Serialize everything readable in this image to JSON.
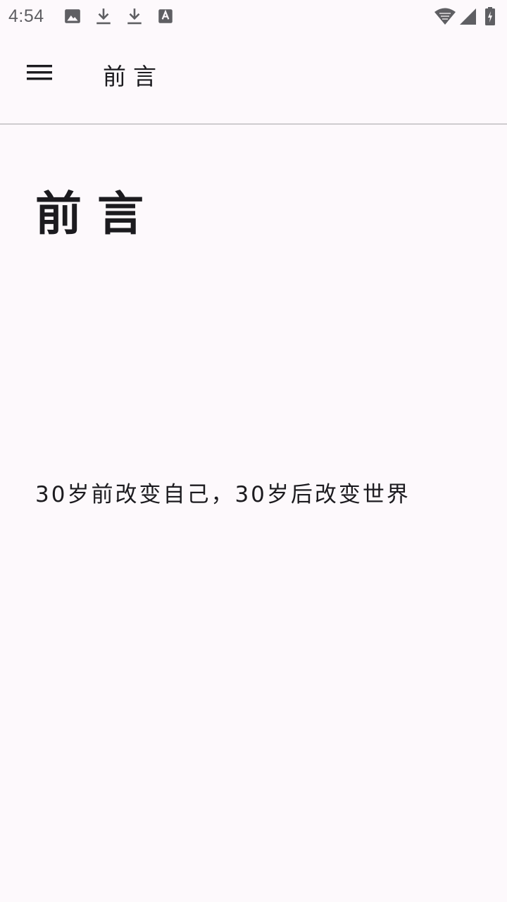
{
  "status_bar": {
    "time": "4:54",
    "icons": [
      "image-icon",
      "download-icon",
      "download-icon",
      "text-icon",
      "wifi-icon",
      "signal-icon",
      "battery-charging-icon"
    ]
  },
  "app_bar": {
    "title": "前言",
    "menu_icon": "menu-icon"
  },
  "content": {
    "title": "前言",
    "body": "30岁前改变自己，30岁后改变世界"
  },
  "colors": {
    "background": "#fdf9fc",
    "text": "#1c1b1f",
    "status_icon": "#5f5f63",
    "divider": "#cfcccf"
  }
}
